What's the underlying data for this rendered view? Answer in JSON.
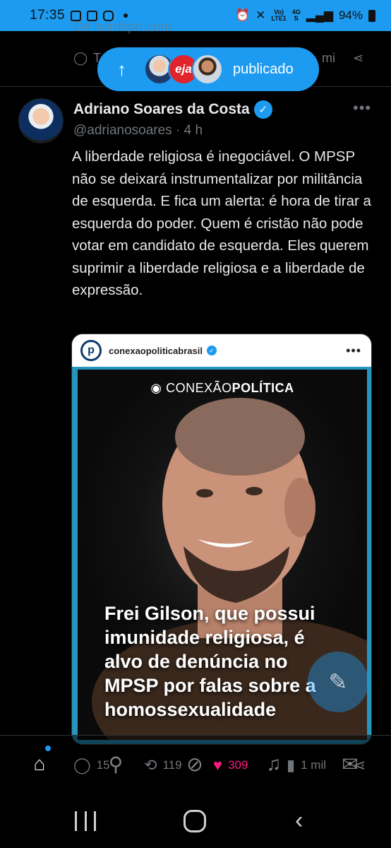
{
  "status_bar": {
    "time": "17:35",
    "network_top": "Vo)",
    "network_bottom": "LTE1",
    "gen_top": "4G",
    "battery": "94%"
  },
  "previous_tweet": {
    "source_fragment": "De nordvpn.com",
    "reply_fragment": "T",
    "views_fragment": "mi"
  },
  "published_toast": {
    "arrow_icon": "arrow-up-icon",
    "avatar_2_text": "eja",
    "label": "publicado"
  },
  "tweet": {
    "author_name": "Adriano Soares da Costa",
    "handle": "@adrianosoares",
    "time": "4 h",
    "handle_time_sep": "·",
    "text": "A liberdade religiosa é inegociável. O MPSP não se deixará instrumentalizar por militância de esquerda. E fica um alerta: é hora de tirar a esquerda do poder. Quem é cristão não pode votar em candidato de esquerda. Eles querem suprimir a liberdade religiosa e a liberdade de expressão.",
    "embed": {
      "account": "conexaopoliticabrasil",
      "brand_light": "CONEXÃO",
      "brand_bold": "POLÍTICA",
      "headline": "Frei Gilson, que possui imunidade religiosa, é alvo de denúncia no MPSP por falas sobre a homossexualidade"
    },
    "actions": {
      "replies": "15",
      "retweets": "119",
      "likes": "309",
      "views": "1 mil"
    }
  },
  "colors": {
    "accent": "#1d9bf0",
    "like": "#f91880",
    "muted": "#71767b",
    "text": "#e7e9ea"
  }
}
